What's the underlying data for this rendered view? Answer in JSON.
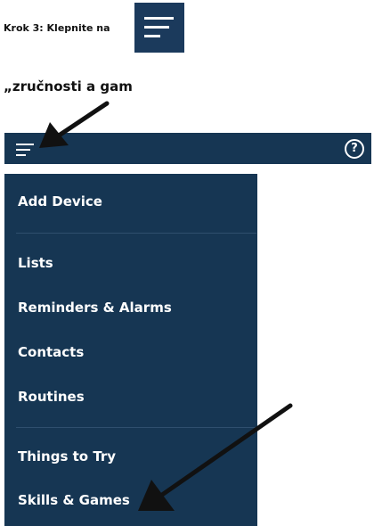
{
  "instruction": {
    "step_text": "Krok 3: Klepnite na",
    "caption": "„zručnosti a gam"
  },
  "topbar": {
    "menu_icon": "hamburger-icon",
    "help_icon": "help-icon",
    "help_glyph": "?"
  },
  "drawer": {
    "items": [
      {
        "label": "Add Device"
      },
      {
        "label": "Lists"
      },
      {
        "label": "Reminders & Alarms"
      },
      {
        "label": "Contacts"
      },
      {
        "label": "Routines"
      },
      {
        "label": "Things to Try"
      },
      {
        "label": "Skills & Games"
      }
    ]
  },
  "colors": {
    "navy": "#163653",
    "icon_navy": "#1b3a5c",
    "text_light": "#ffffff",
    "arrow": "#111111"
  }
}
